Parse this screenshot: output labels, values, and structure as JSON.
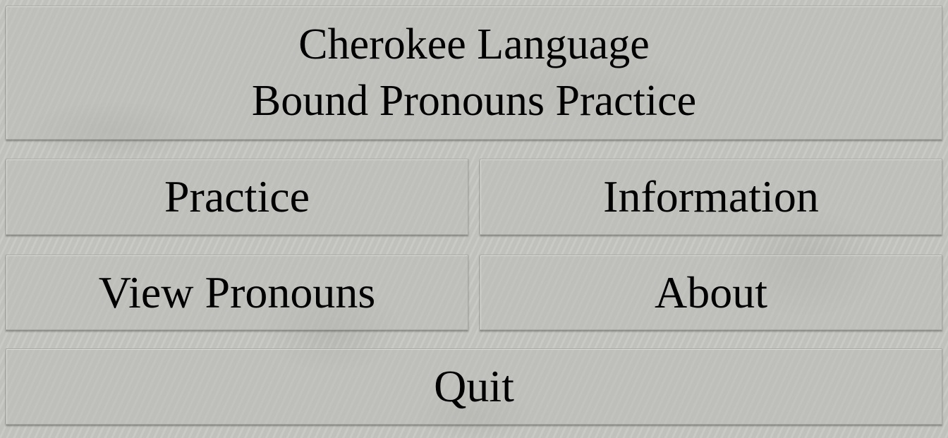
{
  "header": {
    "title_line1": "Cherokee Language",
    "title_line2": "Bound Pronouns Practice"
  },
  "menu": {
    "practice_label": "Practice",
    "information_label": "Information",
    "view_pronouns_label": "View Pronouns",
    "about_label": "About",
    "quit_label": "Quit"
  },
  "colors": {
    "background": "#c6c6c2",
    "text": "#000000"
  }
}
